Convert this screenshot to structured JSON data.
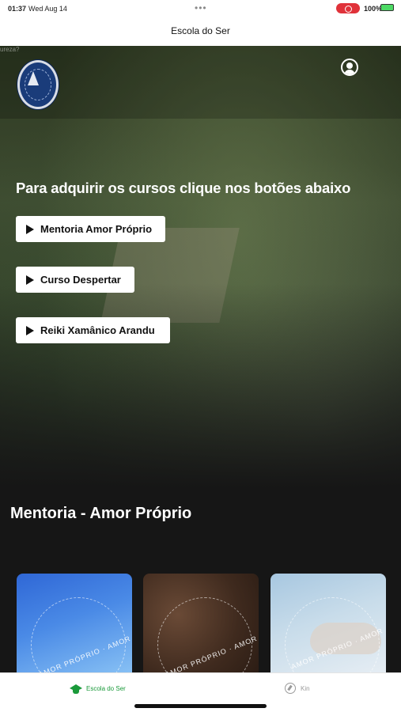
{
  "status_bar": {
    "time": "01:37",
    "date": "Wed Aug 14",
    "dots": "•••",
    "battery": "100%"
  },
  "nav": {
    "title": "Escola do Ser"
  },
  "hero": {
    "watermark": "ureza?",
    "heading": "Para adquirir os cursos clique nos botões abaixo",
    "buttons": [
      {
        "label": "Mentoria Amor Próprio",
        "icon": "play-icon"
      },
      {
        "label": "Curso Despertar",
        "icon": "play-icon"
      },
      {
        "label": "Reiki Xamânico Arandu",
        "icon": "play-icon"
      }
    ]
  },
  "section": {
    "title": "Mentoria - Amor Próprio",
    "cards": [
      {
        "ring_text": "AMOR PRÓPRIO · AMOR PRÓPRIO"
      },
      {
        "ring_text": "AMOR PRÓPRIO · AMOR PRÓPRIO"
      },
      {
        "ring_text": "AMOR PRÓPRIO · AMOR"
      }
    ]
  },
  "tabs": [
    {
      "label": "Escola do Ser",
      "icon": "graduation-cap-icon",
      "active": true,
      "color": "#1a9a3a"
    },
    {
      "label": "Kin",
      "icon": "compass-icon",
      "active": false,
      "color": "#9a9a9a"
    }
  ],
  "colors": {
    "accent_green": "#1a9a3a",
    "record_red": "#e0323a",
    "background_dark": "#161616"
  }
}
